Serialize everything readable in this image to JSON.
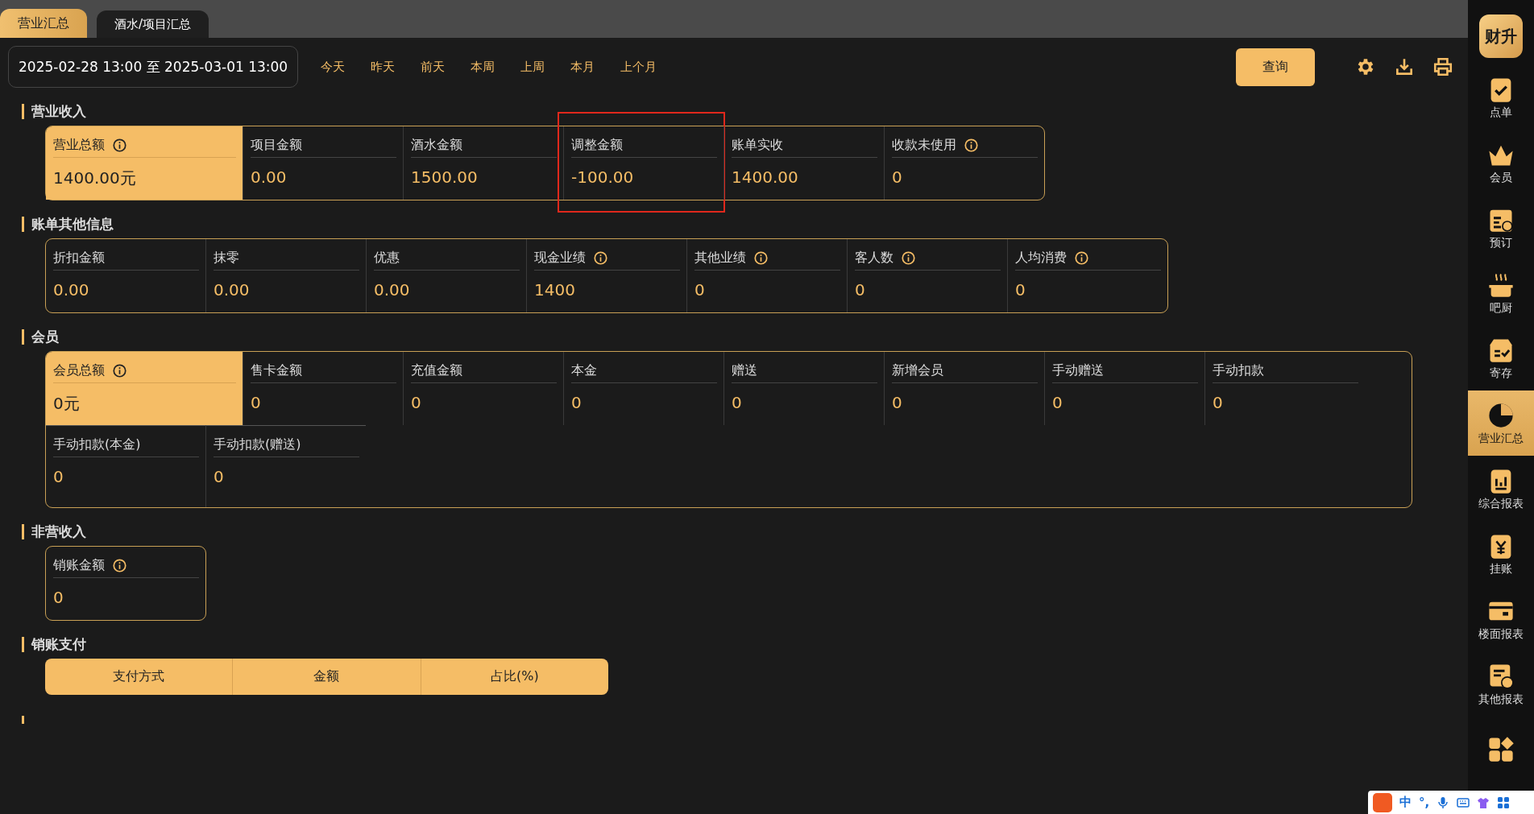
{
  "tabs": [
    {
      "label": "营业汇总",
      "selected": true
    },
    {
      "label": "酒水/项目汇总",
      "selected": false
    }
  ],
  "toolbar": {
    "date_range": "2025-02-28 13:00 至 2025-03-01 13:00",
    "quick_ranges": [
      "今天",
      "昨天",
      "前天",
      "本周",
      "上周",
      "本月",
      "上个月"
    ],
    "query_button": "查询"
  },
  "sections": [
    {
      "title": "营业收入",
      "cards": [
        {
          "label": "营业总额",
          "info": true,
          "value": "1400.00元",
          "featured": true,
          "highlighted": false
        },
        {
          "label": "项目金额",
          "info": false,
          "value": "0.00",
          "featured": false,
          "highlighted": false
        },
        {
          "label": "酒水金额",
          "info": false,
          "value": "1500.00",
          "featured": false,
          "highlighted": false
        },
        {
          "label": "调整金额",
          "info": false,
          "value": "-100.00",
          "featured": false,
          "highlighted": true
        },
        {
          "label": "账单实收",
          "info": false,
          "value": "1400.00",
          "featured": false,
          "highlighted": false
        },
        {
          "label": "收款未使用",
          "info": true,
          "value": "0",
          "featured": false,
          "highlighted": false
        }
      ]
    },
    {
      "title": "账单其他信息",
      "cards": [
        {
          "label": "折扣金额",
          "info": false,
          "value": "0.00",
          "featured": false,
          "highlighted": false
        },
        {
          "label": "抹零",
          "info": false,
          "value": "0.00",
          "featured": false,
          "highlighted": false
        },
        {
          "label": "优惠",
          "info": false,
          "value": "0.00",
          "featured": false,
          "highlighted": false
        },
        {
          "label": "现金业绩",
          "info": true,
          "value": "1400",
          "featured": false,
          "highlighted": false
        },
        {
          "label": "其他业绩",
          "info": true,
          "value": "0",
          "featured": false,
          "highlighted": false
        },
        {
          "label": "客人数",
          "info": true,
          "value": "0",
          "featured": false,
          "highlighted": false
        },
        {
          "label": "人均消费",
          "info": true,
          "value": "0",
          "featured": false,
          "highlighted": false
        }
      ]
    },
    {
      "title": "会员",
      "cards": [
        {
          "label": "会员总额",
          "info": true,
          "value": "0元",
          "featured": true,
          "highlighted": false
        },
        {
          "label": "售卡金额",
          "info": false,
          "value": "0",
          "featured": false,
          "highlighted": false
        },
        {
          "label": "充值金额",
          "info": false,
          "value": "0",
          "featured": false,
          "highlighted": false
        },
        {
          "label": "本金",
          "info": false,
          "value": "0",
          "featured": false,
          "highlighted": false
        },
        {
          "label": "赠送",
          "info": false,
          "value": "0",
          "featured": false,
          "highlighted": false
        },
        {
          "label": "新增会员",
          "info": false,
          "value": "0",
          "featured": false,
          "highlighted": false
        },
        {
          "label": "手动赠送",
          "info": false,
          "value": "0",
          "featured": false,
          "highlighted": false
        },
        {
          "label": "手动扣款",
          "info": false,
          "value": "0",
          "featured": false,
          "highlighted": false
        },
        {
          "label": "手动扣款(本金)",
          "info": false,
          "value": "0",
          "featured": false,
          "highlighted": false
        },
        {
          "label": "手动扣款(赠送)",
          "info": false,
          "value": "0",
          "featured": false,
          "highlighted": false
        }
      ]
    },
    {
      "title": "非营收入",
      "cards": [
        {
          "label": "销账金额",
          "info": true,
          "value": "0",
          "featured": false,
          "highlighted": false
        }
      ]
    }
  ],
  "payment_table": {
    "title": "销账支付",
    "columns": [
      "支付方式",
      "金额",
      "占比(%)"
    ]
  },
  "sidebar": {
    "logo": "财升",
    "items": [
      {
        "label": "点单",
        "selected": false
      },
      {
        "label": "会员",
        "selected": false
      },
      {
        "label": "预订",
        "selected": false
      },
      {
        "label": "吧厨",
        "selected": false
      },
      {
        "label": "寄存",
        "selected": false
      },
      {
        "label": "营业汇总",
        "selected": true
      },
      {
        "label": "综合报表",
        "selected": false
      },
      {
        "label": "挂账",
        "selected": false
      },
      {
        "label": "楼面报表",
        "selected": false
      },
      {
        "label": "其他报表",
        "selected": false
      },
      {
        "selected": false
      }
    ]
  },
  "ime_bar": {
    "mode": "中",
    "punctuation": "°,"
  }
}
